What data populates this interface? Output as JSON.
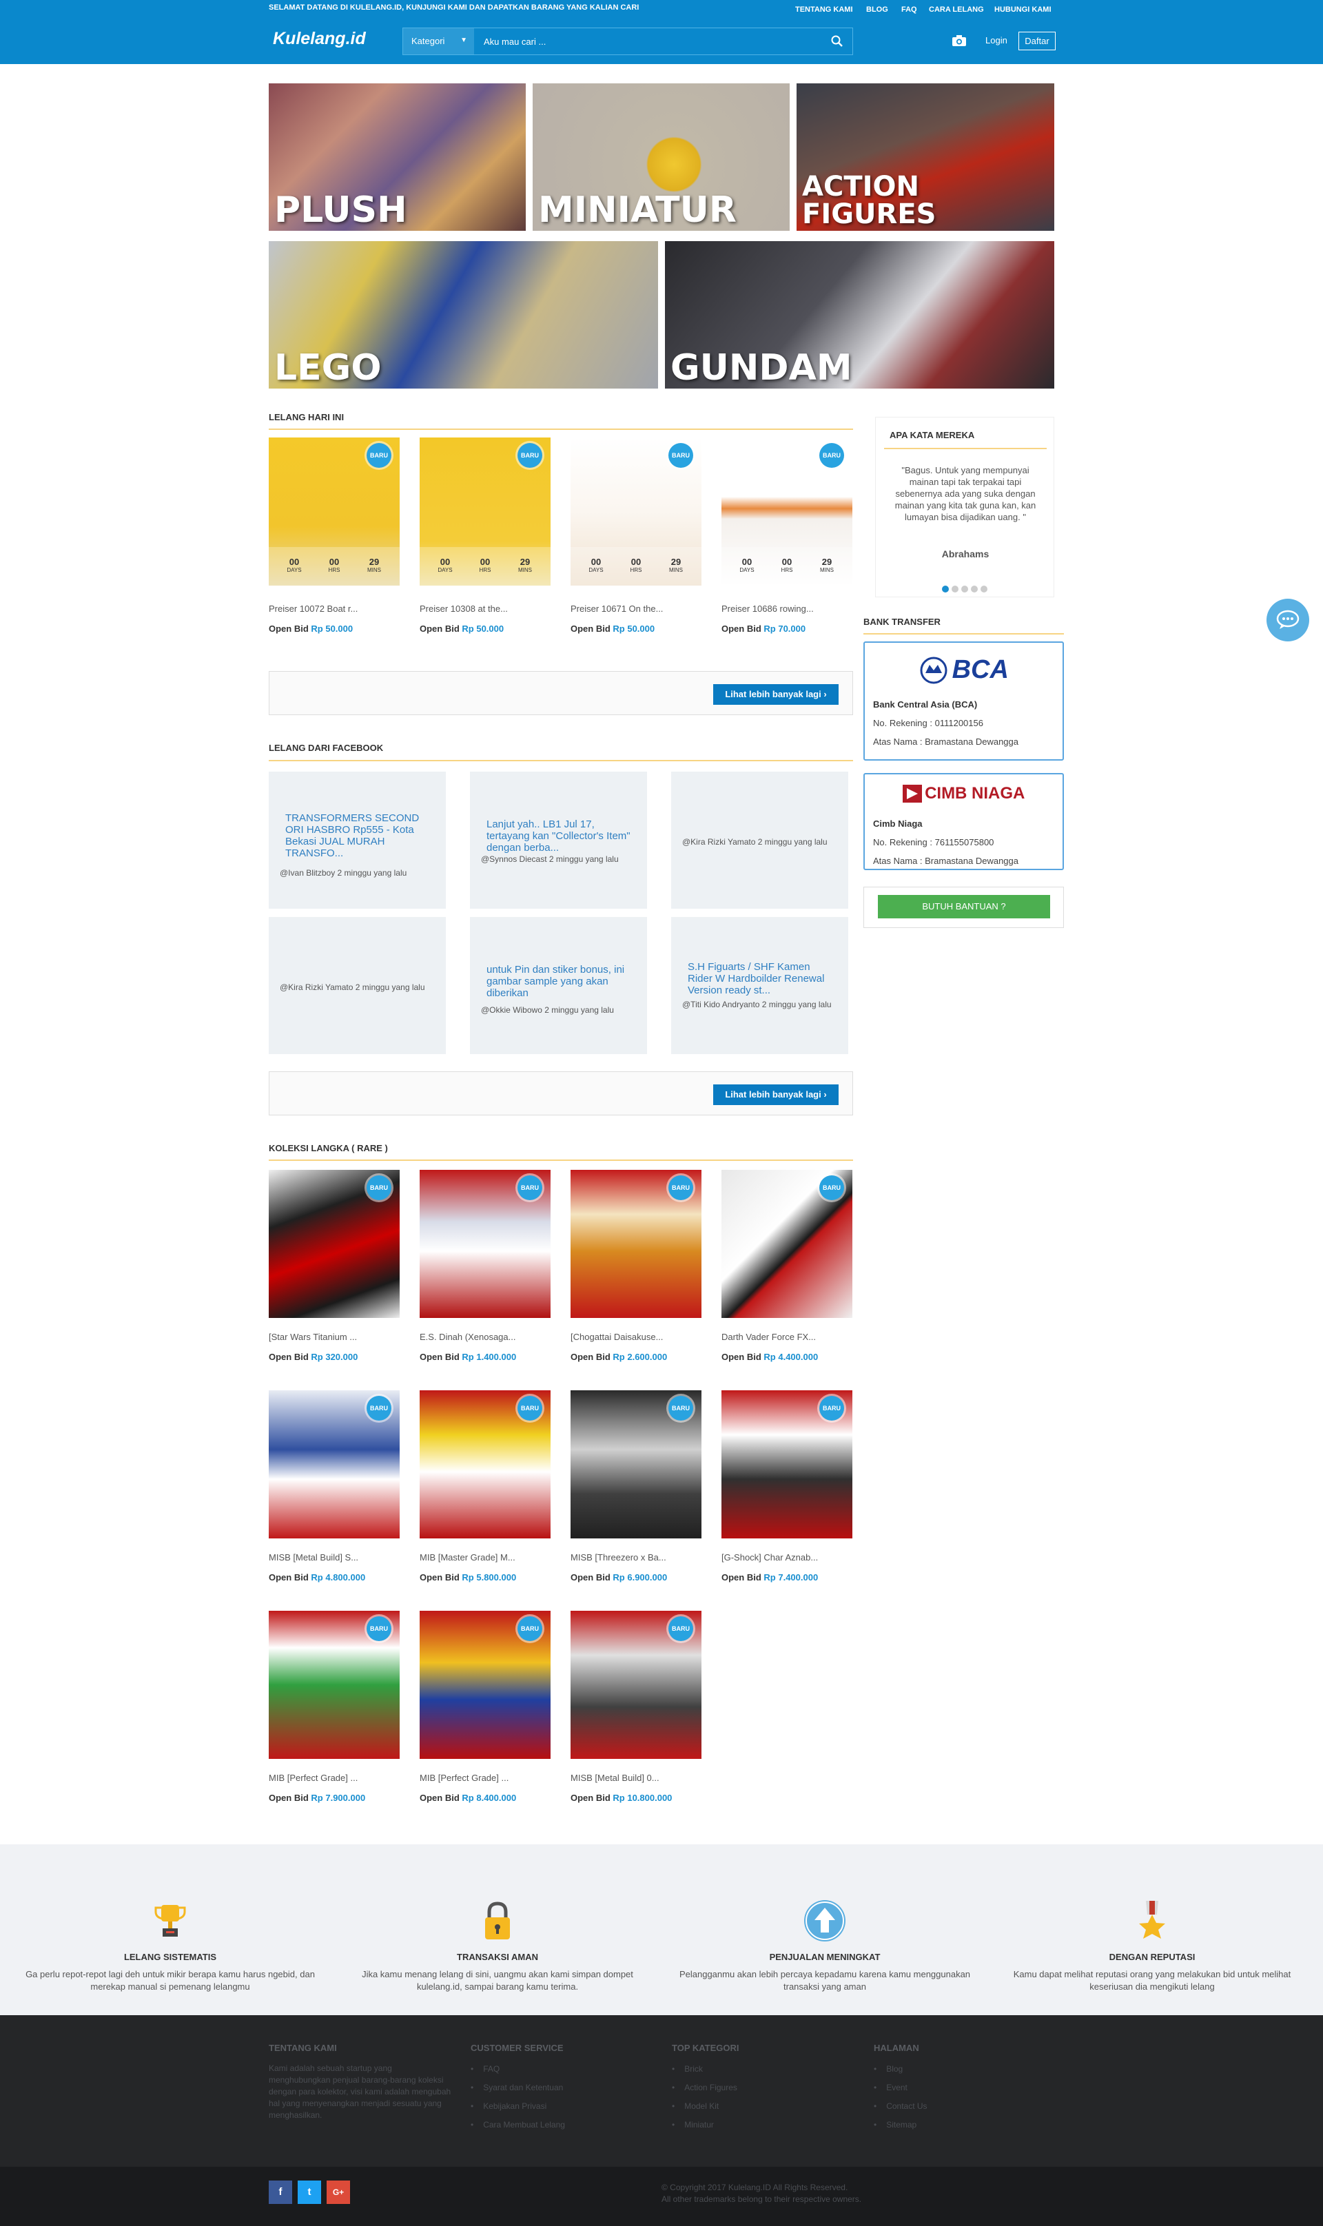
{
  "topbar": {
    "welcome": "SELAMAT DATANG DI KULELANG.ID, KUNJUNGI KAMI DAN DAPATKAN BARANG YANG KALIAN CARI",
    "links": [
      "TENTANG KAMI",
      "BLOG",
      "FAQ",
      "CARA LELANG",
      "HUBUNGI KAMI"
    ]
  },
  "header": {
    "logo": "Kulelang.id",
    "category_label": "Kategori",
    "search_placeholder": "Aku mau cari ...",
    "login": "Login",
    "register": "Daftar"
  },
  "banners": [
    "PLUSH",
    "MINIATUR",
    "ACTION FIGURES",
    "LEGO",
    "GUNDAM"
  ],
  "lelang_hari_ini": {
    "title": "LELANG HARI INI",
    "badge": "BARU",
    "countdown_labels": [
      "DAYS",
      "HRS",
      "MINS"
    ],
    "items": [
      {
        "name": "Preiser 10072 Boat r...",
        "price": "Rp 50.000",
        "d": "00",
        "h": "00",
        "m": "29"
      },
      {
        "name": "Preiser 10308 at the...",
        "price": "Rp 50.000",
        "d": "00",
        "h": "00",
        "m": "29"
      },
      {
        "name": "Preiser 10671 On the...",
        "price": "Rp 50.000",
        "d": "00",
        "h": "00",
        "m": "29"
      },
      {
        "name": "Preiser 10686 rowing...",
        "price": "Rp 70.000",
        "d": "00",
        "h": "00",
        "m": "29"
      }
    ],
    "open_bid": "Open Bid",
    "more": "Lihat lebih banyak lagi ›"
  },
  "facebook": {
    "title": "LELANG DARI FACEBOOK",
    "posts": [
      {
        "text": "TRANSFORMERS SECOND ORI HASBRO Rp555 - Kota Bekasi JUAL MURAH TRANSFO...",
        "meta": "@Ivan Blitzboy 2 minggu yang lalu"
      },
      {
        "text": "Lanjut yah.. LB1 Jul 17, tertayang kan \"Collector's Item\" dengan berba...",
        "meta": "@Synnos Diecast 2 minggu yang lalu"
      },
      {
        "text": "",
        "meta": "@Kira Rizki Yamato 2 minggu yang lalu"
      },
      {
        "text": "",
        "meta": "@Kira Rizki Yamato 2 minggu yang lalu"
      },
      {
        "text": "untuk Pin dan stiker bonus, ini gambar sample yang akan diberikan",
        "meta": "@Okkie Wibowo 2 minggu yang lalu"
      },
      {
        "text": "S.H Figuarts / SHF Kamen Rider W Hardboilder Renewal Version ready st...",
        "meta": "@Titi Kido Andryanto 2 minggu yang lalu"
      }
    ],
    "more": "Lihat lebih banyak lagi ›"
  },
  "koleksi": {
    "title": "KOLEKSI LANGKA ( RARE )",
    "items": [
      {
        "name": "[Star Wars Titanium ...",
        "price": "Rp 320.000"
      },
      {
        "name": "E.S. Dinah (Xenosaga...",
        "price": "Rp 1.400.000"
      },
      {
        "name": "[Chogattai Daisakuse...",
        "price": "Rp 2.600.000"
      },
      {
        "name": "Darth Vader Force FX...",
        "price": "Rp 4.400.000"
      },
      {
        "name": "MISB [Metal Build] S...",
        "price": "Rp 4.800.000"
      },
      {
        "name": "MIB [Master Grade] M...",
        "price": "Rp 5.800.000"
      },
      {
        "name": "MISB [Threezero x Ba...",
        "price": "Rp 6.900.000"
      },
      {
        "name": "[G-Shock] Char Aznab...",
        "price": "Rp 7.400.000"
      },
      {
        "name": "MIB [Perfect Grade] ...",
        "price": "Rp 7.900.000"
      },
      {
        "name": "MIB [Perfect Grade] ...",
        "price": "Rp 8.400.000"
      },
      {
        "name": "MISB [Metal Build] 0...",
        "price": "Rp 10.800.000"
      }
    ]
  },
  "testimonial": {
    "title": "APA KATA MEREKA",
    "quote": "\"Bagus. Untuk yang mempunyai mainan tapi tak terpakai tapi sebenernya ada yang suka dengan mainan yang kita tak guna kan, kan lumayan bisa dijadikan uang. \"",
    "author": "Abrahams"
  },
  "bank": {
    "title": "BANK TRANSFER",
    "accounts": [
      {
        "logo": "BCA",
        "name": "Bank Central Asia (BCA)",
        "rek": "No. Rekening : 0111200156",
        "atas": "Atas Nama : Bramastana Dewangga"
      },
      {
        "logo": "CIMB NIAGA",
        "name": "Cimb Niaga",
        "rek": "No. Rekening : 761155075800",
        "atas": "Atas Nama : Bramastana Dewangga"
      }
    ],
    "help": "BUTUH BANTUAN ?"
  },
  "features": [
    {
      "title": "LELANG SISTEMATIS",
      "text": "Ga perlu repot-repot lagi deh untuk mikir berapa kamu harus ngebid, dan merekap manual si pemenang lelangmu",
      "icon": "trophy-icon"
    },
    {
      "title": "TRANSAKSI AMAN",
      "text": "Jika kamu menang lelang di sini, uangmu akan kami simpan dompet kulelang.id, sampai barang kamu terima.",
      "icon": "lock-icon"
    },
    {
      "title": "PENJUALAN MENINGKAT",
      "text": "Pelangganmu akan lebih percaya kepadamu karena kamu menggunakan transaksi yang aman",
      "icon": "arrow-up-icon"
    },
    {
      "title": "DENGAN REPUTASI",
      "text": "Kamu dapat melihat reputasi orang yang melakukan bid untuk melihat keseriusan dia mengikuti lelang",
      "icon": "medal-icon"
    }
  ],
  "footer": {
    "about_title": "TENTANG KAMI",
    "about_text": "Kami adalah sebuah startup yang menghubungkan penjual barang-barang koleksi dengan para kolektor, visi kami adalah mengubah hal yang menyenangkan menjadi sesuatu yang menghasilkan.",
    "cs_title": "CUSTOMER SERVICE",
    "cs_links": [
      "FAQ",
      "Syarat dan Ketentuan",
      "Kebijakan Privasi",
      "Cara Membuat Lelang"
    ],
    "top_title": "TOP KATEGORI",
    "top_links": [
      "Brick",
      "Action Figures",
      "Model Kit",
      "Miniatur"
    ],
    "page_title": "HALAMAN",
    "page_links": [
      "Blog",
      "Event",
      "Contact Us",
      "Sitemap"
    ],
    "copy1": "© Copyright 2017 Kulelang.ID All Rights Reserved.",
    "copy2": "All other trademarks belong to their respective owners.",
    "social": [
      "f",
      "t",
      "G+"
    ]
  }
}
